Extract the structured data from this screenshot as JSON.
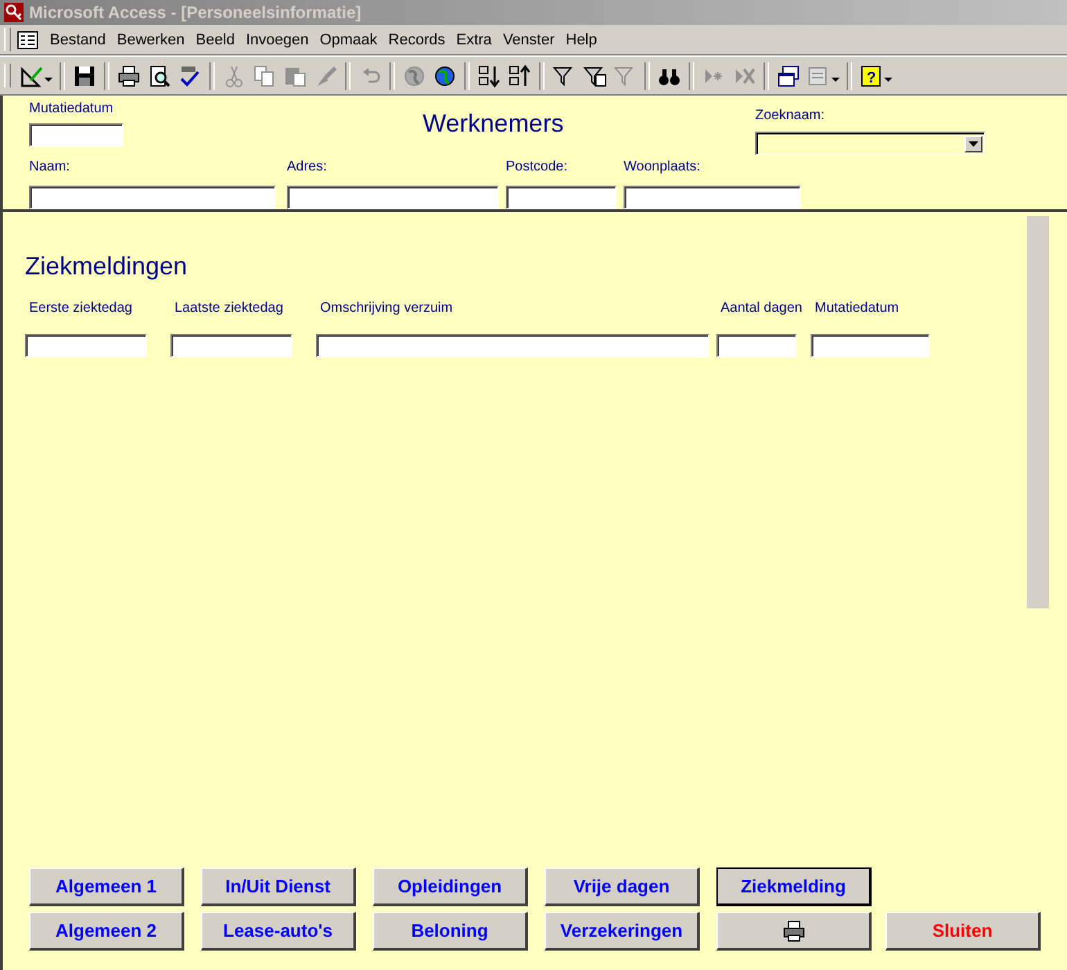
{
  "window": {
    "title": "Microsoft Access - [Personeelsinformatie]",
    "active": false
  },
  "menu": [
    "Bestand",
    "Bewerken",
    "Beeld",
    "Invoegen",
    "Opmaak",
    "Records",
    "Extra",
    "Venster",
    "Help"
  ],
  "toolbar": {
    "groups": [
      [
        {
          "kind": "design",
          "disabled": false,
          "dropdown": true
        }
      ],
      [
        {
          "kind": "save",
          "disabled": false,
          "dropdown": false
        }
      ],
      [
        {
          "kind": "print",
          "disabled": false,
          "dropdown": false
        },
        {
          "kind": "preview",
          "disabled": false,
          "dropdown": false
        },
        {
          "kind": "spelling",
          "disabled": false,
          "dropdown": false
        }
      ],
      [
        {
          "kind": "cut",
          "disabled": true,
          "dropdown": false
        },
        {
          "kind": "copy",
          "disabled": true,
          "dropdown": false
        },
        {
          "kind": "paste",
          "disabled": true,
          "dropdown": false
        },
        {
          "kind": "brush",
          "disabled": true,
          "dropdown": false
        }
      ],
      [
        {
          "kind": "undo",
          "disabled": true,
          "dropdown": false
        }
      ],
      [
        {
          "kind": "globe",
          "disabled": true,
          "dropdown": false
        },
        {
          "kind": "globe",
          "disabled": false,
          "dropdown": false
        }
      ],
      [
        {
          "kind": "sort-asc",
          "disabled": false,
          "dropdown": false
        },
        {
          "kind": "sort-desc",
          "disabled": false,
          "dropdown": false
        }
      ],
      [
        {
          "kind": "filter",
          "disabled": false,
          "dropdown": false
        },
        {
          "kind": "filter-form",
          "disabled": false,
          "dropdown": false
        },
        {
          "kind": "filter",
          "disabled": true,
          "dropdown": false
        }
      ],
      [
        {
          "kind": "find",
          "disabled": false,
          "dropdown": false
        }
      ],
      [
        {
          "kind": "new-record",
          "disabled": true,
          "dropdown": false
        },
        {
          "kind": "delete-record",
          "disabled": true,
          "dropdown": false
        }
      ],
      [
        {
          "kind": "window",
          "disabled": false,
          "dropdown": false
        },
        {
          "kind": "new-object",
          "disabled": true,
          "dropdown": true
        }
      ],
      [
        {
          "kind": "help",
          "disabled": false,
          "dropdown": true,
          "glyph": "?"
        }
      ]
    ]
  },
  "header": {
    "title": "Werknemers",
    "mutation_date": {
      "label": "Mutatiedatum"
    },
    "search": {
      "label": "Zoeknaam:"
    },
    "fields": [
      {
        "label": "Naam:"
      },
      {
        "label": "Adres:"
      },
      {
        "label": "Postcode:"
      },
      {
        "label": "Woonplaats:"
      }
    ]
  },
  "detail": {
    "title": "Ziekmeldingen",
    "columns": [
      {
        "label": "Eerste ziektedag"
      },
      {
        "label": "Laatste ziektedag"
      },
      {
        "label": "Omschrijving verzuim"
      },
      {
        "label": "Aantal dagen"
      },
      {
        "label": "Mutatiedatum"
      }
    ]
  },
  "button_rows": [
    [
      {
        "kind": "nav",
        "label": "Algemeen 1",
        "selected": false
      },
      {
        "kind": "nav",
        "label": "In/Uit Dienst",
        "selected": false
      },
      {
        "kind": "nav",
        "label": "Opleidingen",
        "selected": false
      },
      {
        "kind": "nav",
        "label": "Vrije dagen",
        "selected": false
      },
      {
        "kind": "nav",
        "label": "Ziekmelding",
        "selected": true
      }
    ],
    [
      {
        "kind": "nav",
        "label": "Algemeen 2",
        "selected": false
      },
      {
        "kind": "nav",
        "label": "Lease-auto's",
        "selected": false
      },
      {
        "kind": "nav",
        "label": "Beloning",
        "selected": false
      },
      {
        "kind": "nav",
        "label": "Verzekeringen",
        "selected": false
      },
      {
        "kind": "print",
        "selected": false
      },
      {
        "kind": "close",
        "label": "Sluiten",
        "selected": false
      }
    ]
  ]
}
